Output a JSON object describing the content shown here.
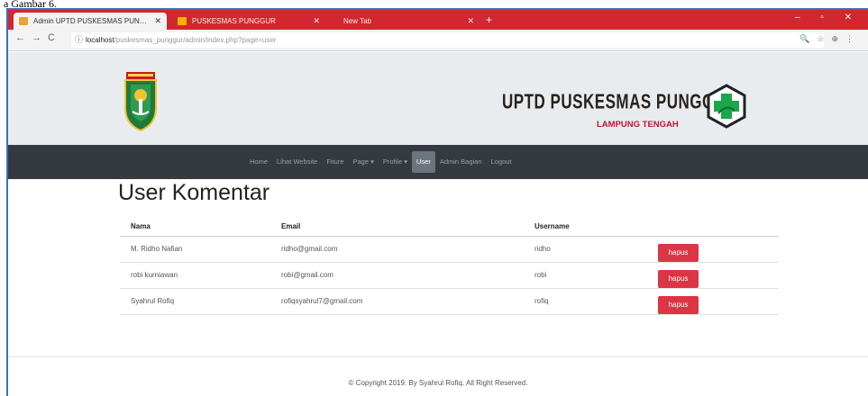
{
  "doc_caption": "a Gambar 6.",
  "browser": {
    "tabs": [
      {
        "title": "Admin UPTD PUSKESMAS PUN…",
        "active": true
      },
      {
        "title": "PUSKESMAS PUNGGUR",
        "active": false
      },
      {
        "title": "New Tab",
        "active": false
      }
    ],
    "url_host": "localhost",
    "url_path": "/puskesmas_punggur/admin/index.php?page=user"
  },
  "header": {
    "title": "UPTD PUSKESMAS PUNGGUR",
    "subtitle": "LAMPUNG TENGAH"
  },
  "nav": {
    "items": [
      {
        "label": "Home"
      },
      {
        "label": "Lihat Website"
      },
      {
        "label": "Fiture"
      },
      {
        "label": "Page ▾"
      },
      {
        "label": "Profile ▾"
      },
      {
        "label": "User"
      },
      {
        "label": "Admin Bagian"
      },
      {
        "label": "Logout"
      }
    ],
    "active_index": 5
  },
  "page": {
    "title": "User Komentar"
  },
  "table": {
    "headers": [
      "Nama",
      "Email",
      "Username"
    ],
    "rows": [
      {
        "nama": "M. Ridho Nafian",
        "email": "ridho@gmail.com",
        "username": "ridho",
        "action": "hapus"
      },
      {
        "nama": "robi kurniawan",
        "email": "robi@gmail.com",
        "username": "robi",
        "action": "hapus"
      },
      {
        "nama": "Syahrul Rofiq",
        "email": "rofiqsyahrul7@gmail.com",
        "username": "rofiq",
        "action": "hapus"
      }
    ]
  },
  "footer": {
    "text": "© Copyright 2019. By Syahrul Rofiq. All Right Reserved."
  },
  "colors": {
    "tabbar": "#d1282f",
    "navbar": "#343a40",
    "banner": "#e9ecef",
    "danger": "#dc3545",
    "subtitle": "#c4122f"
  }
}
